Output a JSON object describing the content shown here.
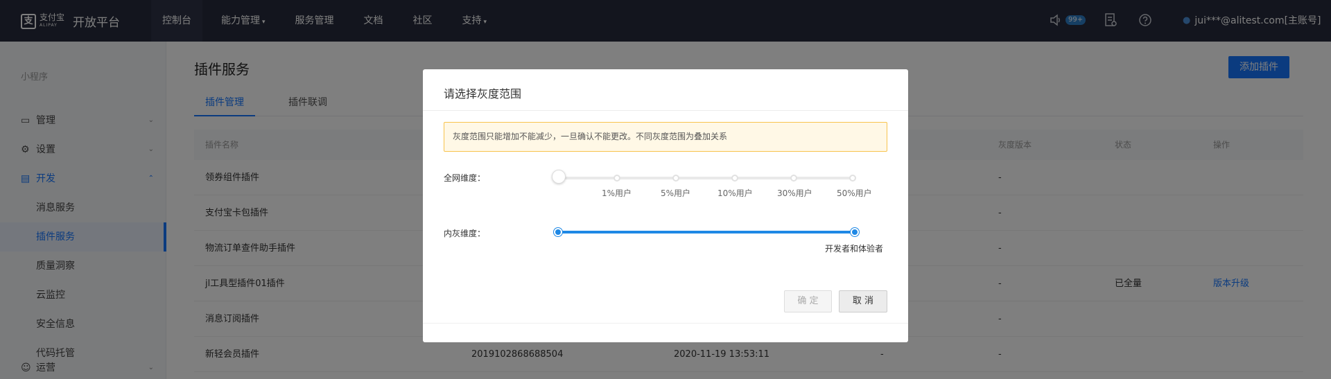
{
  "topbar": {
    "logo_mark": "支",
    "logo_brand": "支付宝",
    "logo_brand_en": "ALIPAY",
    "logo_title": "开放平台",
    "nav": [
      {
        "label": "控制台",
        "caret": ""
      },
      {
        "label": "能力管理",
        "caret": "▾"
      },
      {
        "label": "服务管理",
        "caret": ""
      },
      {
        "label": "文档",
        "caret": ""
      },
      {
        "label": "社区",
        "caret": ""
      },
      {
        "label": "支持",
        "caret": "▾"
      }
    ],
    "badge": "99+",
    "user": "jui***@alitest.com[主账号]"
  },
  "sidebar": {
    "heading": "小程序",
    "items": [
      {
        "label": "管理",
        "chev": "⌄"
      },
      {
        "label": "设置",
        "chev": "⌄"
      },
      {
        "label": "开发",
        "chev": "⌃"
      },
      {
        "label": "运营",
        "chev": "⌄"
      }
    ],
    "subitems": [
      "消息服务",
      "插件服务",
      "质量洞察",
      "云监控",
      "安全信息",
      "代码托管"
    ]
  },
  "main": {
    "title": "插件服务",
    "add_button": "添加插件",
    "tabs": [
      "插件管理",
      "插件联调"
    ],
    "columns": [
      "插件名称",
      "",
      "",
      "",
      "灰度版本",
      "状态",
      "操作"
    ],
    "rows": [
      {
        "name": "领券组件插件",
        "id": "",
        "time": "",
        "ver": "",
        "gray": "-",
        "status": "",
        "op": ""
      },
      {
        "name": "支付宝卡包插件",
        "id": "",
        "time": "",
        "ver": "",
        "gray": "-",
        "status": "",
        "op": ""
      },
      {
        "name": "物流订单查件助手插件",
        "id": "",
        "time": "",
        "ver": "",
        "gray": "-",
        "status": "",
        "op": ""
      },
      {
        "name": "jl工具型插件01插件",
        "id": "",
        "time": "",
        "ver": "",
        "gray": "-",
        "status": "已全量",
        "op": "版本升级"
      },
      {
        "name": "消息订阅插件",
        "id": "",
        "time": "",
        "ver": "",
        "gray": "-",
        "status": "",
        "op": ""
      },
      {
        "name": "新轻会员插件",
        "id": "2019102868688504",
        "time": "2020-11-19 13:53:11",
        "ver": "-",
        "gray": "-",
        "status": "",
        "op": ""
      }
    ]
  },
  "modal": {
    "title": "请选择灰度范围",
    "alert": "灰度范围只能增加不能减少，一旦确认不能更改。不同灰度范围为叠加关系",
    "network_label": "全网维度：",
    "network_marks": [
      "1%用户",
      "5%用户",
      "10%用户",
      "30%用户",
      "50%用户"
    ],
    "network_value_percent": 0,
    "internal_label": "内灰维度：",
    "internal_mark": "开发者和体验者",
    "internal_selected": true,
    "ok": "确 定",
    "cancel": "取 消"
  },
  "colors": {
    "primary": "#1677ff",
    "nav_bg": "#272b3c",
    "slider": "#1e88e5",
    "alert_border": "#f8c34c"
  }
}
